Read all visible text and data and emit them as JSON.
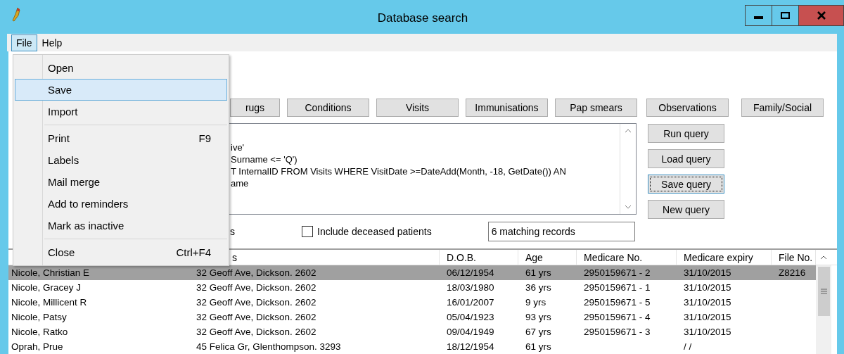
{
  "window": {
    "title": "Database search"
  },
  "menubar": [
    {
      "label": "File",
      "selected": true
    },
    {
      "label": "Help",
      "selected": false
    }
  ],
  "file_menu": [
    {
      "label": "Open",
      "selected": false,
      "separator_after": false
    },
    {
      "label": "Save",
      "selected": true,
      "separator_after": false
    },
    {
      "label": "Import",
      "selected": false,
      "separator_after": true
    },
    {
      "label": "Print",
      "shortcut": "F9",
      "selected": false,
      "separator_after": false
    },
    {
      "label": "Labels",
      "selected": false,
      "separator_after": false
    },
    {
      "label": "Mail merge",
      "selected": false,
      "separator_after": false
    },
    {
      "label": "Add to reminders",
      "selected": false,
      "separator_after": false
    },
    {
      "label": "Mark as inactive",
      "selected": false,
      "separator_after": true
    },
    {
      "label": "Close",
      "shortcut": "Ctrl+F4",
      "selected": false,
      "separator_after": false
    }
  ],
  "category_buttons": [
    "rugs",
    "Conditions",
    "Visits",
    "Immunisations",
    "Pap smears",
    "Observations",
    "Family/Social"
  ],
  "query_lines": [
    "ive'",
    "Surname <= 'Q')",
    "T InternalID FROM Visits WHERE VisitDate >=DateAdd(Month, -18, GetDate()) AN",
    "ame"
  ],
  "query_buttons": [
    {
      "label": "Run query",
      "focused": false
    },
    {
      "label": "Load query",
      "focused": false
    },
    {
      "label": "Save query",
      "focused": true
    },
    {
      "label": "New query",
      "focused": false
    }
  ],
  "options_fragment": "s",
  "include_deceased": {
    "label": "Include deceased patients",
    "checked": false
  },
  "match_count": "6 matching records",
  "table": {
    "columns": [
      "",
      "s",
      "D.O.B.",
      "Age",
      "Medicare No.",
      "Medicare expiry",
      "File No."
    ],
    "rows": [
      {
        "cells": [
          "Nicole, Christian E",
          "32 Geoff Ave, Dickson. 2602",
          "06/12/1954",
          "61 yrs",
          "2950159671 - 2",
          "31/10/2015",
          "Z8216"
        ],
        "selected": true
      },
      {
        "cells": [
          "Nicole, Gracey J",
          "32 Geoff Ave, Dickson. 2602",
          "18/03/1980",
          "36 yrs",
          "2950159671 - 1",
          "31/10/2015",
          ""
        ],
        "selected": false
      },
      {
        "cells": [
          "Nicole, Millicent R",
          "32 Geoff Ave, Dickson. 2602",
          "16/01/2007",
          "9 yrs",
          "2950159671 - 5",
          "31/10/2015",
          ""
        ],
        "selected": false
      },
      {
        "cells": [
          "Nicole, Patsy",
          "32 Geoff Ave, Dickson. 2602",
          "05/04/1923",
          "93 yrs",
          "2950159671 - 4",
          "31/10/2015",
          ""
        ],
        "selected": false
      },
      {
        "cells": [
          "Nicole, Ratko",
          "32 Geoff Ave, Dickson. 2602",
          "09/04/1949",
          "67 yrs",
          "2950159671 - 3",
          "31/10/2015",
          ""
        ],
        "selected": false
      },
      {
        "cells": [
          "Oprah, Prue",
          "45 Felica Gr, Glenthompson. 3293",
          "18/12/1954",
          "61 yrs",
          "",
          " / /",
          ""
        ],
        "selected": false
      }
    ]
  }
}
